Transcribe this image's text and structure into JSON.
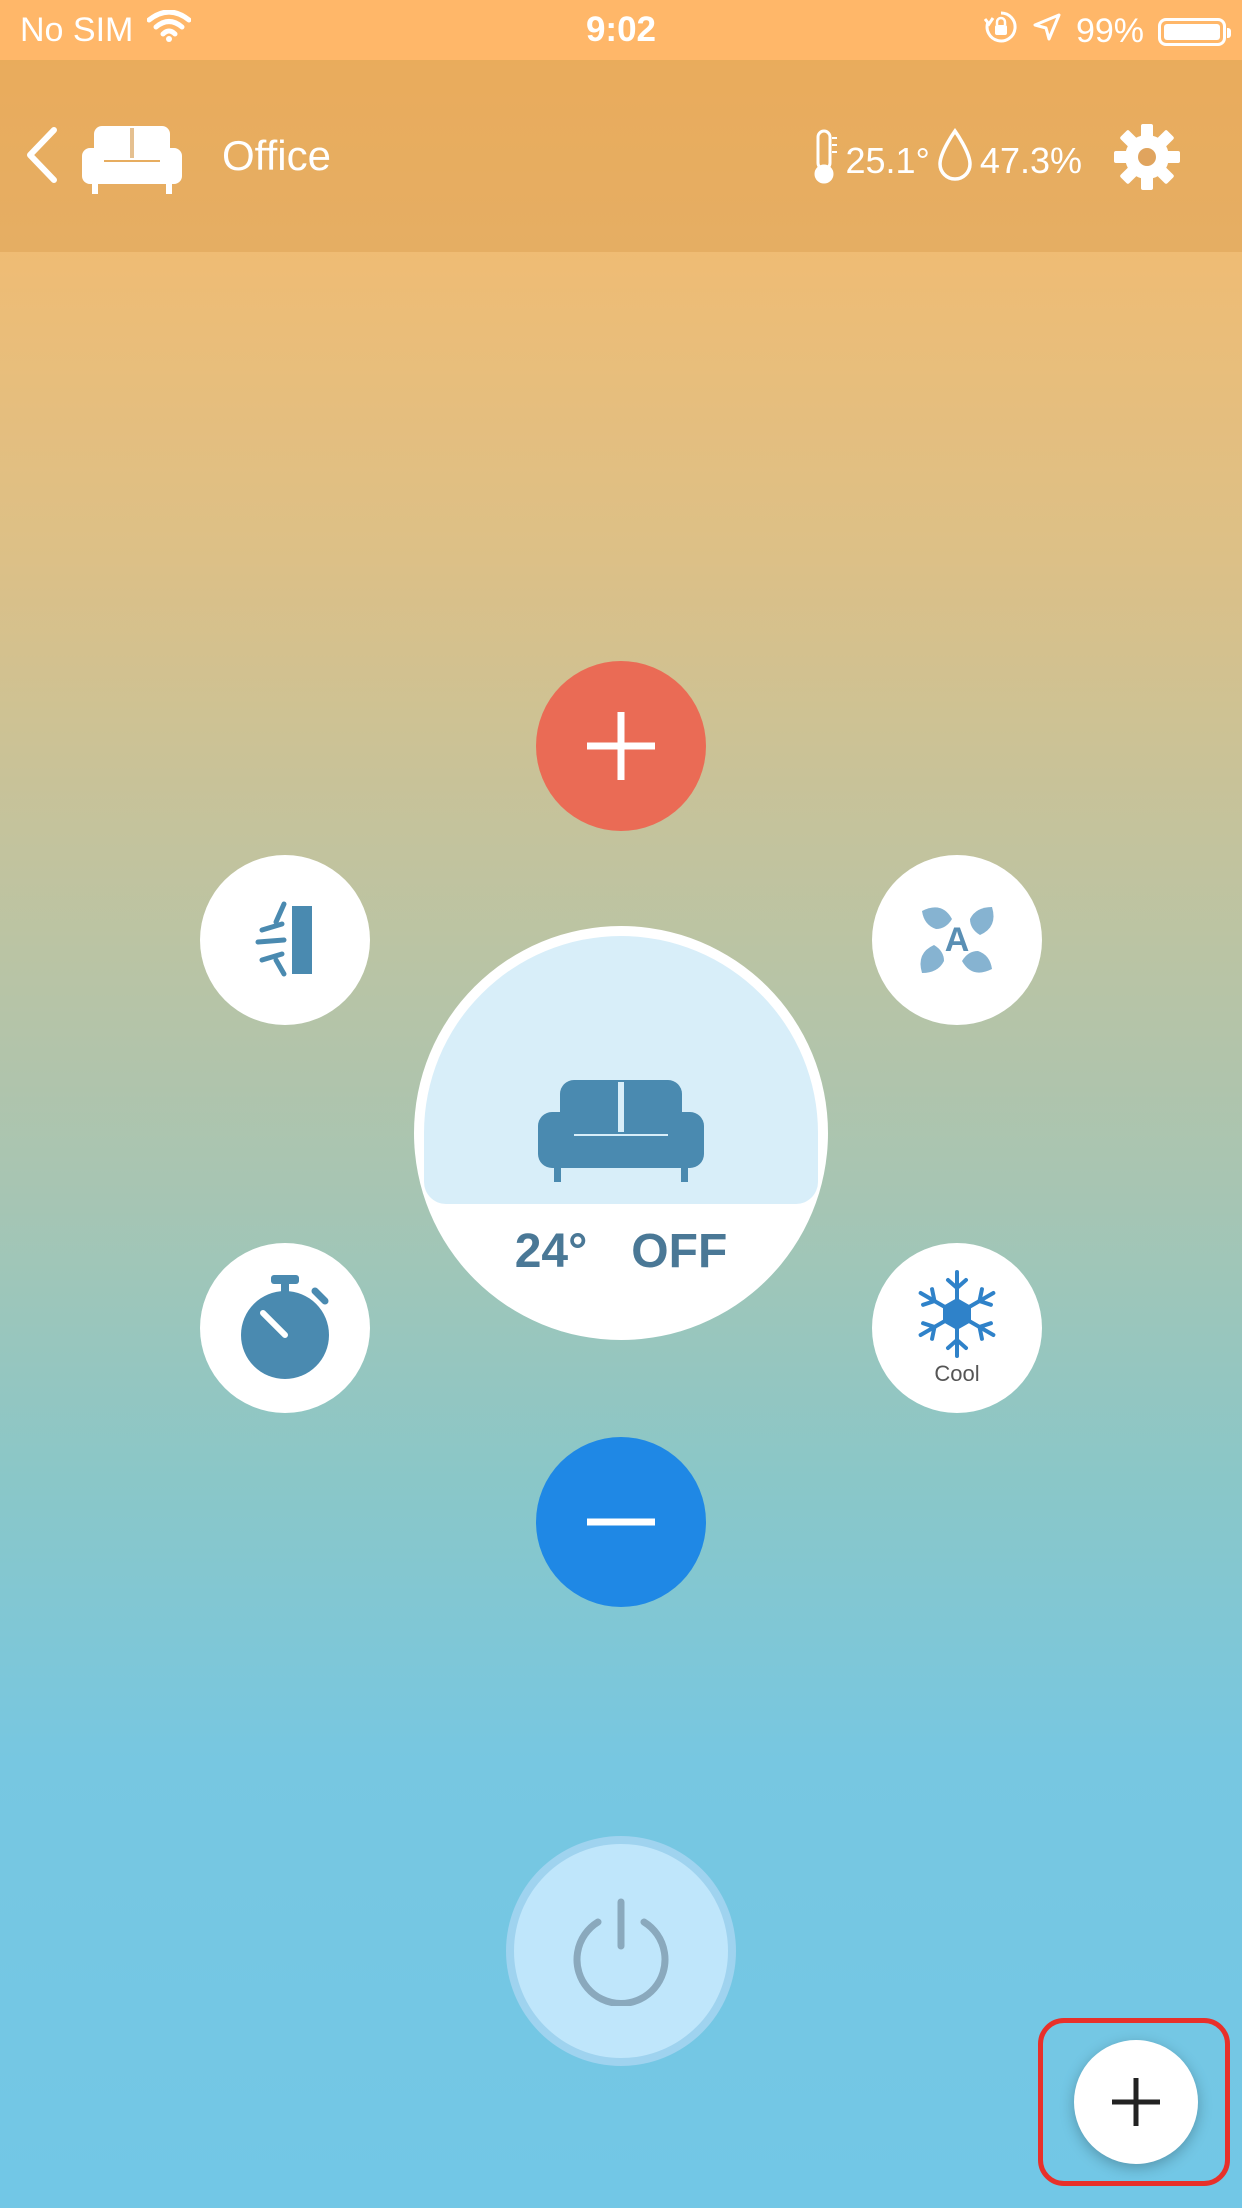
{
  "status_bar": {
    "carrier": "No SIM",
    "time": "9:02",
    "battery": "99%",
    "battery_level": 0.99
  },
  "header": {
    "room_name": "Office",
    "temperature": "25.1°",
    "humidity": "47.3%",
    "icons": [
      "back-chevron-icon",
      "sofa-icon",
      "thermometer-icon",
      "droplet-icon",
      "gear-icon"
    ]
  },
  "controls": {
    "set_temperature": "24°",
    "power_state": "OFF",
    "mode_label": "Cool",
    "icons": {
      "increase": "plus-icon",
      "decrease": "minus-icon",
      "swing": "swing-icon",
      "fan": "fan-auto-icon",
      "timer": "stopwatch-icon",
      "mode": "snowflake-icon",
      "power": "power-icon",
      "add": "plus-icon"
    }
  },
  "colors": {
    "increase_button": "#ea6b55",
    "decrease_button": "#1f88e5",
    "icon_blue": "#4a8ab0",
    "highlight": "#e8302a"
  }
}
